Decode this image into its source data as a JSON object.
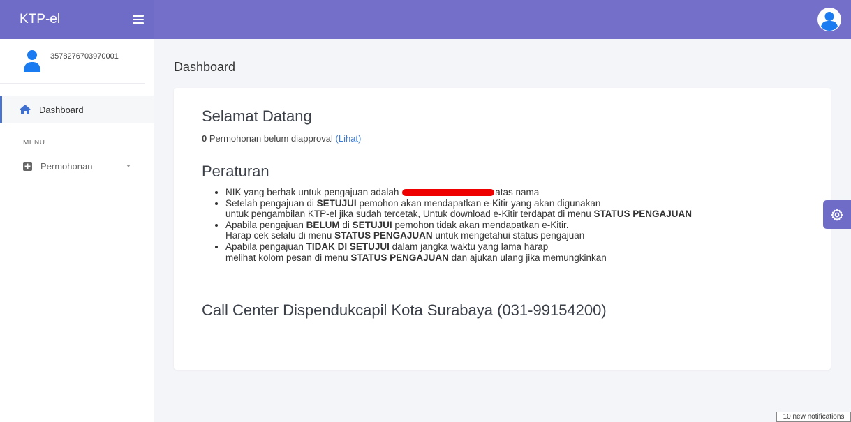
{
  "brand": {
    "title": "KTP-el"
  },
  "user": {
    "id": "3578276703970001"
  },
  "sidebar": {
    "items": [
      {
        "label": "Dashboard",
        "icon": "home-icon",
        "active": true
      }
    ],
    "menu_header": "MENU",
    "menu_items": [
      {
        "label": "Permohonan",
        "icon": "plus-square-icon"
      }
    ]
  },
  "page": {
    "title": "Dashboard"
  },
  "card": {
    "welcome": "Selamat Datang",
    "pending_count": "0",
    "pending_text": " Permohonan belum diapproval ",
    "pending_link": "(Lihat)",
    "rules_title": "Peraturan",
    "rules": {
      "r1_a": "NIK yang berhak untuk pengajuan adalah ",
      "r1_b": "atas nama",
      "r2_a": "Setelah pengajuan di ",
      "r2_b": "SETUJUI",
      "r2_c": " pemohon akan mendapatkan e-Kitir yang akan digunakan",
      "r2_d": "untuk pengambilan KTP-el jika sudah tercetak, Untuk download e-Kitir terdapat di menu ",
      "r2_e": "STATUS PENGAJUAN",
      "r3_a": "Apabila pengajuan ",
      "r3_b": "BELUM",
      "r3_c": " di ",
      "r3_d": "SETUJUI",
      "r3_e": " pemohon tidak akan mendapatkan e-Kitir.",
      "r3_f": "Harap cek selalu di menu ",
      "r3_g": "STATUS PENGAJUAN",
      "r3_h": " untuk mengetahui status pengajuan",
      "r4_a": "Apabila pengajuan ",
      "r4_b": "TIDAK DI SETUJUI",
      "r4_c": " dalam jangka waktu yang lama harap",
      "r4_d": "melihat kolom pesan di menu ",
      "r4_e": "STATUS PENGAJUAN",
      "r4_f": " dan ajukan ulang jika memungkinkan"
    },
    "call_center": "Call Center Dispendukcapil Kota Surabaya (031-99154200)"
  },
  "notifications": {
    "label": "10 new notifications"
  },
  "colors": {
    "topbar": "#7470c9",
    "brand": "#6f6cc7",
    "link": "#3d7bd6",
    "avatar": "#1a7cf0"
  }
}
